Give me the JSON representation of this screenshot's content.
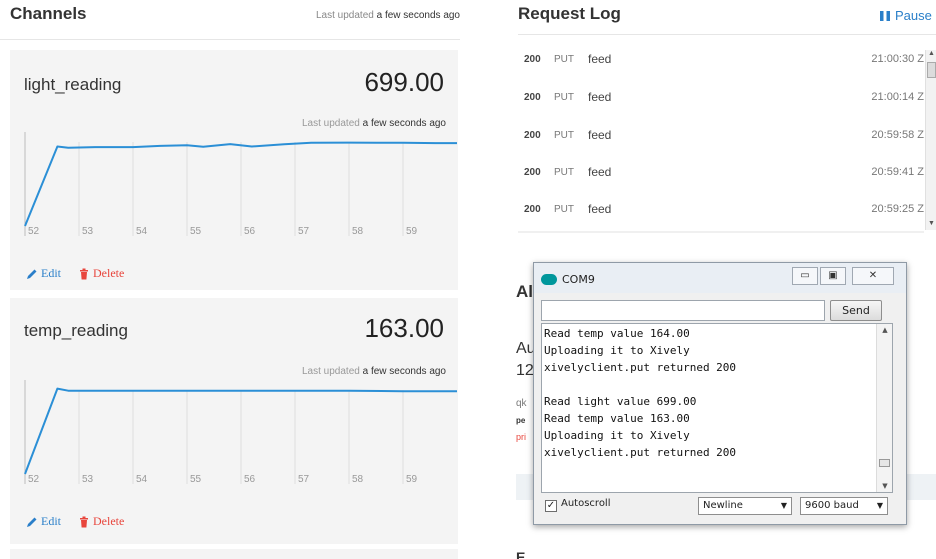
{
  "channels": {
    "title": "Channels",
    "updated_muted": "Last updated",
    "updated_value": "a few seconds ago",
    "items": [
      {
        "name": "light_reading",
        "value": "699.00",
        "updated_muted": "Last updated",
        "updated_value": "a few seconds ago",
        "edit_label": "Edit",
        "delete_label": "Delete",
        "chart_data": {
          "type": "line",
          "x_tick_labels": [
            "52",
            "53",
            "54",
            "55",
            "56",
            "57",
            "58",
            "59"
          ],
          "x": [
            52.0,
            52.6,
            52.8,
            53.3,
            54.0,
            54.5,
            55.0,
            55.3,
            55.8,
            56.2,
            56.8,
            57.3,
            58.0,
            58.5,
            59.0,
            59.6,
            60.0
          ],
          "y": [
            0,
            660,
            650,
            655,
            655,
            665,
            670,
            658,
            680,
            660,
            678,
            690,
            692,
            690,
            690,
            688,
            688
          ],
          "ylim": [
            0,
            780
          ],
          "grid": "vertical"
        }
      },
      {
        "name": "temp_reading",
        "value": "163.00",
        "updated_muted": "Last updated",
        "updated_value": "a few seconds ago",
        "edit_label": "Edit",
        "delete_label": "Delete",
        "chart_data": {
          "type": "line",
          "x_tick_labels": [
            "52",
            "53",
            "54",
            "55",
            "56",
            "57",
            "58",
            "59"
          ],
          "x": [
            52.0,
            52.6,
            52.8,
            53.3,
            54.0,
            55.0,
            56.0,
            57.0,
            58.0,
            59.0,
            60.0
          ],
          "y": [
            0,
            168,
            164,
            164,
            164,
            164,
            164,
            164,
            164,
            163,
            163
          ],
          "ylim": [
            0,
            185
          ],
          "grid": "vertical"
        }
      }
    ]
  },
  "request_log": {
    "title": "Request Log",
    "pause_label": "Pause",
    "rows": [
      {
        "status": "200",
        "method": "PUT",
        "path": "feed",
        "time": "21:00:30 Z"
      },
      {
        "status": "200",
        "method": "PUT",
        "path": "feed",
        "time": "21:00:14 Z"
      },
      {
        "status": "200",
        "method": "PUT",
        "path": "feed",
        "time": "20:59:58 Z"
      },
      {
        "status": "200",
        "method": "PUT",
        "path": "feed",
        "time": "20:59:41 Z"
      },
      {
        "status": "200",
        "method": "PUT",
        "path": "feed",
        "time": "20:59:25 Z"
      }
    ]
  },
  "background_section": {
    "heading": "Al",
    "line_a": "Au",
    "line_b": "12",
    "line_c": "qk",
    "line_d": "pe",
    "line_e": "pri",
    "footer": "E"
  },
  "serial_monitor": {
    "title": "COM9",
    "minimize_label": "▭",
    "maximize_label": "▣",
    "close_label": "✕",
    "send_input_value": "",
    "send_label": "Send",
    "output_lines": [
      "Read temp value 164.00",
      "Uploading it to Xively",
      "xivelyclient.put returned 200",
      "",
      "Read light value 699.00",
      "Read temp value 163.00",
      "Uploading it to Xively",
      "xivelyclient.put returned 200"
    ],
    "autoscroll_label": "Autoscroll",
    "autoscroll_checked": true,
    "line_ending_selected": "Newline",
    "baud_selected": "9600 baud"
  },
  "colors": {
    "chart_line": "#2b8fd6",
    "link_blue": "#2a7fc9",
    "delete_red": "#e8453c",
    "card_bg": "#f4f4f4",
    "arduino_teal": "#00979c"
  },
  "icons": {
    "edit": "pencil-icon",
    "delete": "trash-icon",
    "pause": "pause-icon",
    "com_window": "arduino-infinity-icon"
  }
}
